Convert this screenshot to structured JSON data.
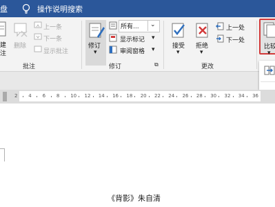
{
  "title_bar": {
    "left_fragment": "盘",
    "tell_me": "操作说明搜索"
  },
  "ribbon": {
    "left_fragment_top": "建",
    "left_fragment_bottom": "注",
    "comments": {
      "delete_label": "删除",
      "previous_label": "上一条",
      "next_label": "下一条",
      "show_comments_label": "显示批注",
      "group_label": "批注"
    },
    "tracking": {
      "track_changes_label": "修订",
      "markup_dropdown_value": "所有...",
      "show_markup_label": "显示标记",
      "reviewing_pane_label": "审阅窗格",
      "group_label": "修订",
      "launcher_glyph": "⧉"
    },
    "changes": {
      "accept_label": "接受",
      "reject_label": "拒绝",
      "previous_label": "上一处",
      "next_label": "下一处",
      "group_label": "更改"
    },
    "compare": {
      "label": "比较"
    }
  },
  "ruler": {
    "ticks": [
      "2",
      "4",
      "6",
      "8",
      "10",
      "12",
      "14",
      "16",
      "18",
      "20",
      "22",
      "24",
      "26",
      "28",
      "30",
      "32",
      "34",
      "36"
    ]
  },
  "document": {
    "text": "《背影》朱自清"
  },
  "colors": {
    "titlebar": "#2b579a",
    "highlight": "#d23a3a",
    "accent_blue": "#2f6fbe"
  }
}
